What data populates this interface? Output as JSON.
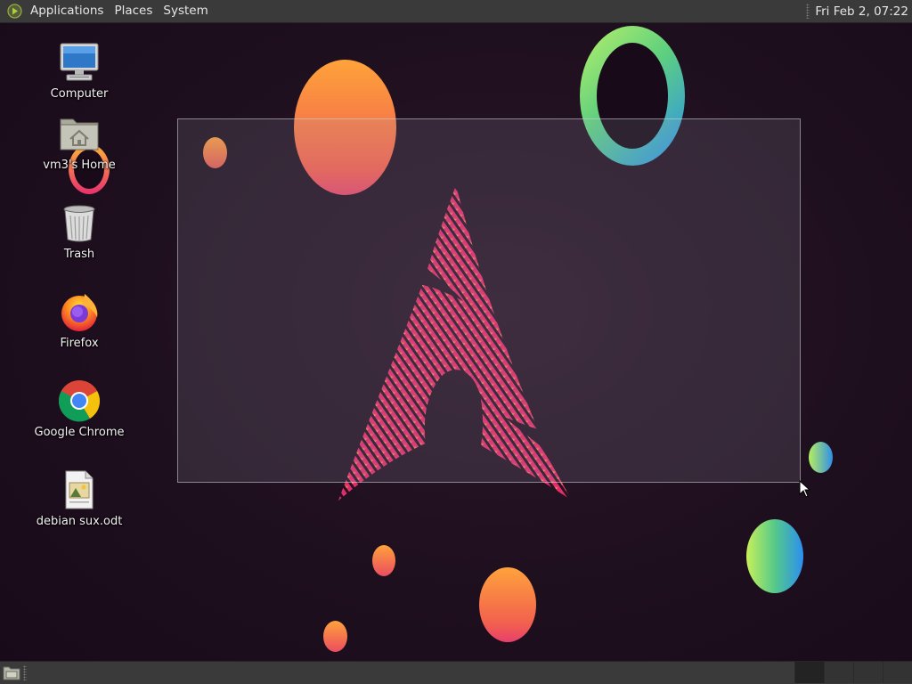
{
  "top_panel": {
    "menus": [
      "Applications",
      "Places",
      "System"
    ],
    "clock": "Fri Feb  2, 07:22"
  },
  "desktop": {
    "icons": [
      {
        "label": "Computer",
        "icon": "computer-icon"
      },
      {
        "label": "vm3's Home",
        "icon": "home-folder-icon"
      },
      {
        "label": "Trash",
        "icon": "trash-icon"
      },
      {
        "label": "Firefox",
        "icon": "firefox-icon"
      },
      {
        "label": "Google Chrome",
        "icon": "chrome-icon"
      },
      {
        "label": "debian sux.odt",
        "icon": "document-icon"
      }
    ]
  },
  "bottom_panel": {
    "workspaces": 4,
    "active_workspace": 1
  },
  "colors": {
    "panel": "#3a3a3a",
    "desktop_bg": "#1e0f1e",
    "accent_pink": "#e8306e",
    "accent_orange": "#ffa23c"
  }
}
